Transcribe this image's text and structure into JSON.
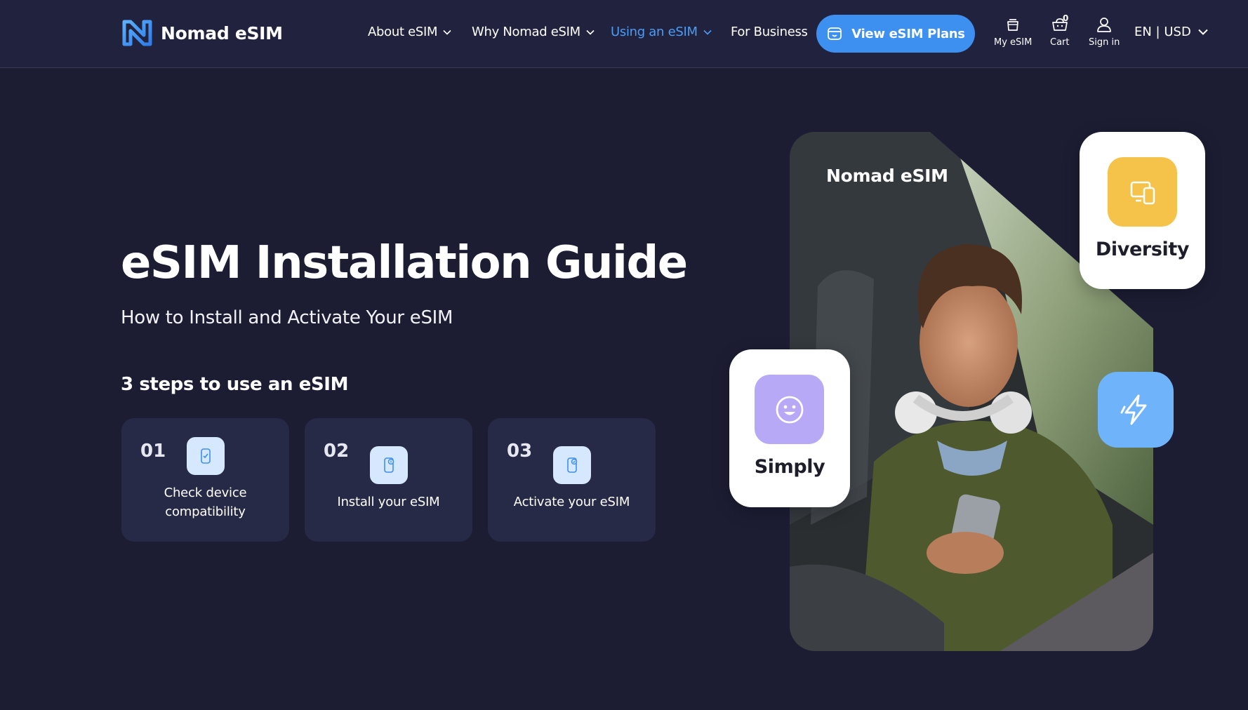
{
  "header": {
    "brand": "Nomad eSIM",
    "nav": [
      {
        "label": "About eSIM",
        "has_dropdown": true,
        "active": false
      },
      {
        "label": "Why Nomad eSIM",
        "has_dropdown": true,
        "active": false
      },
      {
        "label": "Using an eSIM",
        "has_dropdown": true,
        "active": true
      },
      {
        "label": "For Business",
        "has_dropdown": false,
        "active": false
      }
    ],
    "cta_label": "View eSIM Plans",
    "my_esim_label": "My eSIM",
    "cart_label": "Cart",
    "cart_count": "0",
    "sign_in_label": "Sign in",
    "locale_label": "EN | USD"
  },
  "hero": {
    "title": "eSIM Installation Guide",
    "subtitle": "How to Install and Activate Your eSIM",
    "steps_heading": "3 steps to use an eSIM",
    "steps": [
      {
        "number": "01",
        "label_line1": "Check device",
        "label_line2": "compatibility",
        "icon": "phone-check-icon"
      },
      {
        "number": "02",
        "label_line1": "Install your eSIM",
        "label_line2": "",
        "icon": "phone-install-icon"
      },
      {
        "number": "03",
        "label_line1": "Activate your eSIM",
        "label_line2": "",
        "icon": "phone-activate-icon"
      }
    ]
  },
  "visual": {
    "photo_brand": "Nomad eSIM",
    "cards": [
      {
        "label": "Diversity",
        "icon": "devices-icon",
        "color": "#f5c24a"
      },
      {
        "label": "Simply",
        "icon": "smile-icon",
        "color": "#b7a9f5"
      },
      {
        "label": "",
        "icon": "lightning-icon",
        "color": "#6fb3fb"
      }
    ]
  },
  "colors": {
    "background": "#1c1d33",
    "header_bg": "#21233e",
    "accent": "#3d8ff0",
    "active_nav": "#4c9bf5",
    "step_card": "#272a47"
  }
}
